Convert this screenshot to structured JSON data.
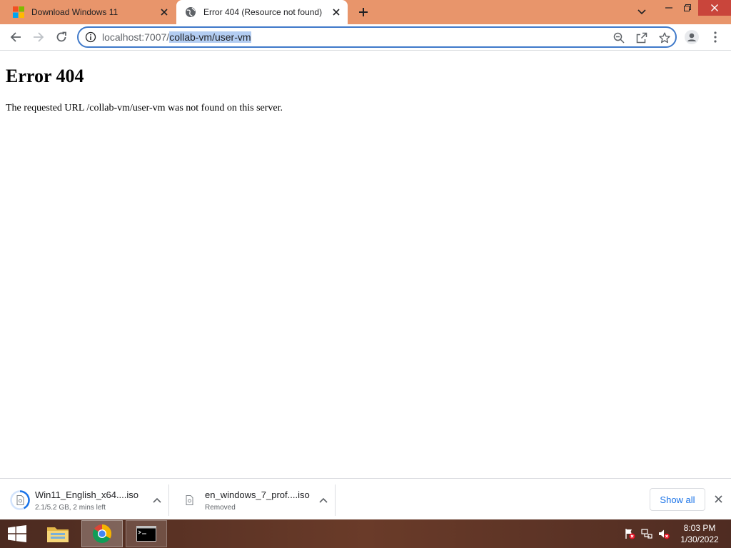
{
  "tabs": [
    {
      "title": "Download Windows 11"
    },
    {
      "title": "Error 404 (Resource not found)"
    }
  ],
  "address_bar": {
    "url_host": "localhost:7007/",
    "url_path": "collab-vm/user-vm"
  },
  "page": {
    "title": "Error 404",
    "message": "The requested URL /collab-vm/user-vm was not found on this server."
  },
  "downloads": [
    {
      "name": "Win11_English_x64....iso",
      "status": "2.1/5.2 GB, 2 mins left"
    },
    {
      "name": "en_windows_7_prof....iso",
      "status": "Removed"
    }
  ],
  "shelf": {
    "show_all_label": "Show all"
  },
  "taskbar": {
    "time": "8:03 PM",
    "date": "1/30/2022"
  },
  "colors": {
    "tabstrip": "#e8956b",
    "accent": "#1a73e8",
    "omnibox_border": "#3f79c9",
    "selection": "#b3cdf2",
    "close_hover": "#c9453b"
  }
}
